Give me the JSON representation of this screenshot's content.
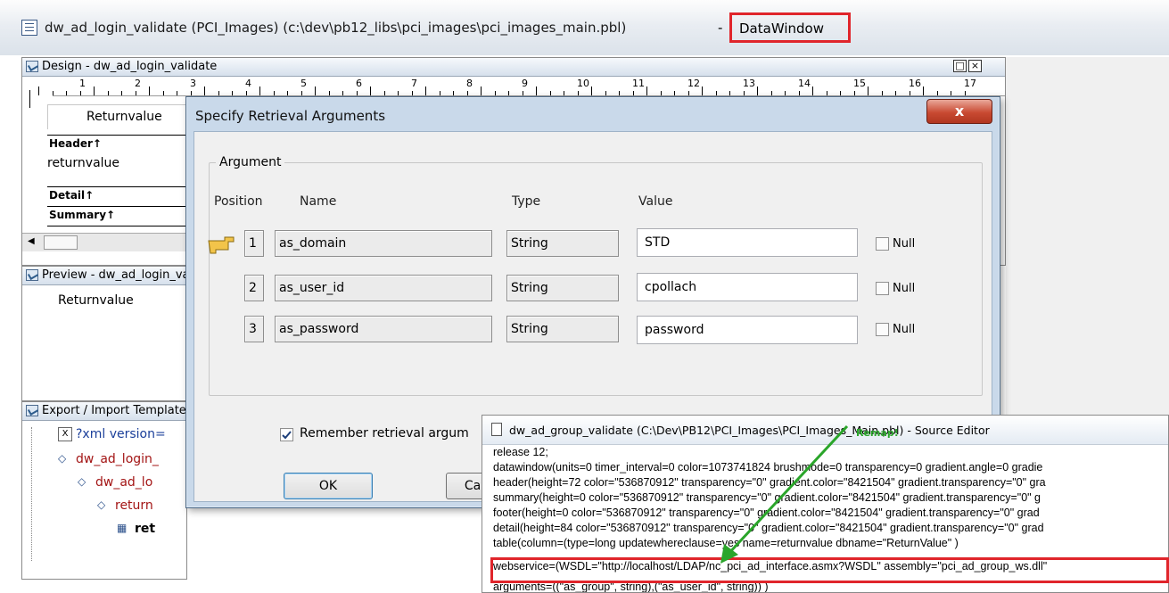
{
  "window": {
    "title": "dw_ad_login_validate  (PCI_Images) (c:\\dev\\pb12_libs\\pci_images\\pci_images_main.pbl)",
    "type_badge": "DataWindow"
  },
  "design_pane": {
    "title": "Design - dw_ad_login_validate",
    "ruler_marks": [
      "1",
      "2",
      "3",
      "4",
      "5",
      "6",
      "7",
      "8",
      "9",
      "10",
      "11",
      "12",
      "13",
      "14",
      "15",
      "16",
      "17"
    ],
    "column_header_text": "Returnvalue",
    "bands": {
      "header": "Header↑",
      "detail": "Detail↑",
      "summary": "Summary↑"
    },
    "column_field": "returnvalue",
    "maximize_glyph": "□",
    "close_glyph": "×"
  },
  "preview_pane": {
    "title": "Preview - dw_ad_login_validate",
    "column_header_text": "Returnvalue"
  },
  "export_pane": {
    "title": "Export / Import Template - XML",
    "tree": [
      {
        "label": "?xml version=",
        "icon": "xml-declaration-icon"
      },
      {
        "label": "dw_ad_login_",
        "icon": "element-icon"
      },
      {
        "label": "dw_ad_lo",
        "icon": "element-icon"
      },
      {
        "label": "return",
        "icon": "element-icon"
      },
      {
        "label": "ret",
        "icon": "column-icon"
      }
    ]
  },
  "dialog": {
    "title": "Specify Retrieval Arguments",
    "close_label": "x",
    "group_label": "Argument",
    "columns": {
      "position": "Position",
      "name": "Name",
      "type": "Type",
      "value": "Value"
    },
    "arguments": [
      {
        "position": "1",
        "name": "as_domain",
        "type": "String",
        "value": "STD",
        "null_label": "Null",
        "null_checked": false
      },
      {
        "position": "2",
        "name": "as_user_id",
        "type": "String",
        "value": "cpollach",
        "null_label": "Null",
        "null_checked": false
      },
      {
        "position": "3",
        "name": "as_password",
        "type": "String",
        "value": "password",
        "null_label": "Null",
        "null_checked": false
      }
    ],
    "remember_label": "Remember retrieval argum",
    "remember_checked": true,
    "ok_label": "OK",
    "cancel_label": "Ca"
  },
  "source_editor": {
    "title": "dw_ad_group_validate (C:\\Dev\\PB12\\PCI_Images\\PCI_Images_Main.pbl) - Source Editor",
    "annotation": "Remap!",
    "lines": [
      "release 12;",
      "datawindow(units=0 timer_interval=0 color=1073741824 brushmode=0 transparency=0 gradient.angle=0 gradie",
      "header(height=72 color=\"536870912\" transparency=\"0\" gradient.color=\"8421504\" gradient.transparency=\"0\" gra",
      "summary(height=0 color=\"536870912\" transparency=\"0\" gradient.color=\"8421504\" gradient.transparency=\"0\" g",
      "footer(height=0 color=\"536870912\" transparency=\"0\" gradient.color=\"8421504\" gradient.transparency=\"0\" grad",
      "detail(height=84 color=\"536870912\" transparency=\"0\" gradient.color=\"8421504\" gradient.transparency=\"0\" grad",
      "table(column=(type=long updatewhereclause=yes name=returnvalue dbname=\"ReturnValue\" )",
      " webservice=(WSDL=\"http://localhost/LDAP/nc_pci_ad_interface.asmx?WSDL\"  assembly=\"pci_ad_group_ws.dll\"",
      "arguments=((\"as_group\", string),(\"as_user_id\", string)) )"
    ]
  },
  "colors": {
    "highlight": "#e0252b",
    "arrow": "#2aa52a",
    "dialog_frame": "#c9d9ea"
  }
}
